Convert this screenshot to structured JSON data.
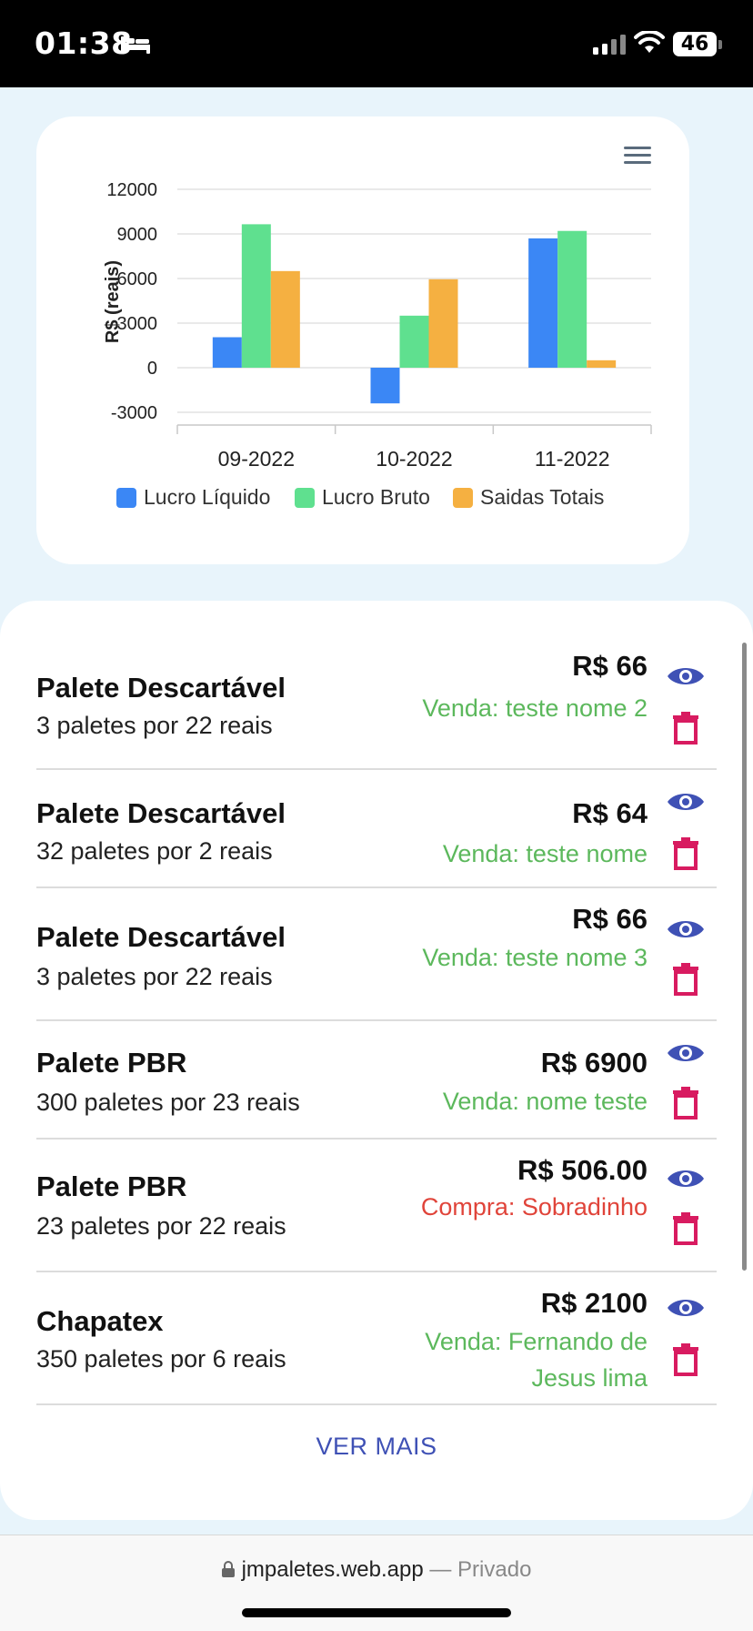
{
  "status": {
    "time": "01:38",
    "battery": "46"
  },
  "chart_data": {
    "type": "bar",
    "categories": [
      "09-2022",
      "10-2022",
      "11-2022"
    ],
    "series": [
      {
        "name": "Lucro Líquido",
        "color": "#3b87f5",
        "values": [
          2050,
          -2400,
          8700
        ]
      },
      {
        "name": "Lucro Bruto",
        "color": "#5fe08f",
        "values": [
          9650,
          3500,
          9200
        ]
      },
      {
        "name": "Saidas Totais",
        "color": "#f5b041",
        "values": [
          6500,
          5950,
          500
        ]
      }
    ],
    "ylabel": "R$ (reais)",
    "ylim": [
      -3000,
      12000
    ],
    "yticks": [
      12000,
      9000,
      6000,
      3000,
      0,
      -3000
    ],
    "grid": true,
    "legend_position": "bottom"
  },
  "items": [
    {
      "title": "Palete Descartável",
      "sub": "3 paletes por 22 reais",
      "price": "R$ 66",
      "note": "Venda: teste nome 2",
      "kind": "sale"
    },
    {
      "title": "Palete Descartável",
      "sub": "32 paletes por 2 reais",
      "price": "R$ 64",
      "note": "Venda: teste nome",
      "kind": "sale"
    },
    {
      "title": "Palete Descartável",
      "sub": "3 paletes por 22 reais",
      "price": "R$ 66",
      "note": "Venda: teste nome 3",
      "kind": "sale"
    },
    {
      "title": "Palete PBR",
      "sub": "300 paletes por 23 reais",
      "price": "R$ 6900",
      "note": "Venda: nome teste",
      "kind": "sale"
    },
    {
      "title": "Palete PBR",
      "sub": "23 paletes por 22 reais",
      "price": "R$ 506.00",
      "note": "Compra: Sobradinho",
      "kind": "buy"
    },
    {
      "title": "Chapatex",
      "sub": "350 paletes por 6 reais",
      "price": "R$ 2100",
      "note": "Venda: Fernando de Jesus lima",
      "kind": "sale"
    }
  ],
  "ver_mais_label": "VER MAIS",
  "url_bar": {
    "domain": "jmpaletes.web.app",
    "separator": " — ",
    "private_label": "Privado"
  },
  "icons": {
    "eye": "eye-icon",
    "trash": "trash-icon",
    "menu": "hamburger-menu-icon",
    "lock": "lock-icon"
  },
  "colors": {
    "eye": "#3f51b5",
    "trash": "#d81b60",
    "sale": "#5cb85c",
    "buy": "#e0443a",
    "link": "#3f51b5"
  }
}
